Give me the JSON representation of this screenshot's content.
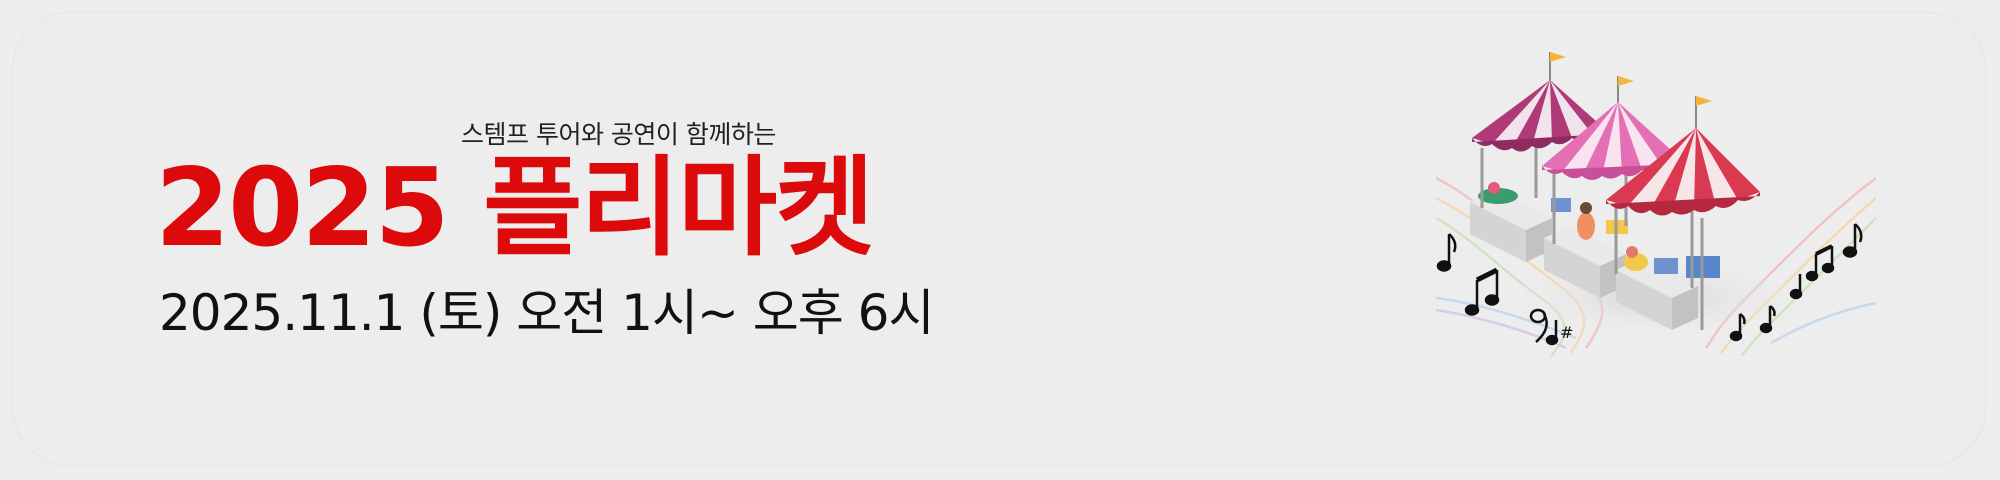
{
  "banner": {
    "subtitle": "스템프 투어와 공연이 함께하는",
    "title": "2025 플리마켓",
    "date": "2025.11.1 (토) 오전 1시~ 오후 6시",
    "colors": {
      "background": "#ededed",
      "title": "#dc0a0a",
      "text": "#111111"
    },
    "illustration": {
      "icons": [
        "market-tent-icon",
        "flag-icon",
        "music-note-icon",
        "sharp-sign-icon"
      ]
    }
  }
}
